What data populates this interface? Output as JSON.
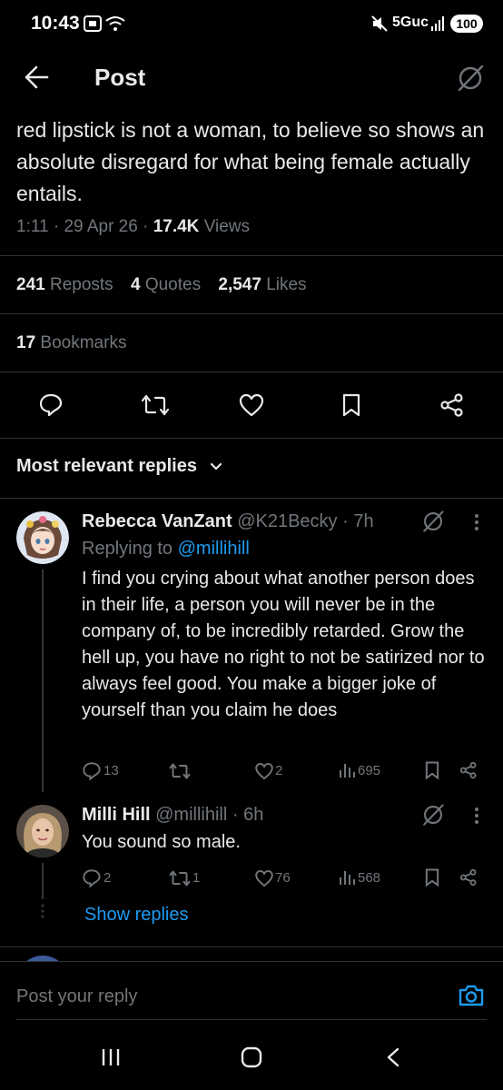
{
  "status_bar": {
    "time": "10:43",
    "network": "5Guc",
    "battery": "100"
  },
  "header": {
    "title": "Post"
  },
  "post": {
    "text": "red lipstick is not a woman, to believe so shows an absolute disregard for what being female actually entails.",
    "time": "1:11",
    "date": "29 Apr 26",
    "views_count": "17.4K",
    "views_label": "Views",
    "reposts_count": "241",
    "reposts_label": "Reposts",
    "quotes_count": "4",
    "quotes_label": "Quotes",
    "likes_count": "2,547",
    "likes_label": "Likes",
    "bookmarks_count": "17",
    "bookmarks_label": "Bookmarks"
  },
  "sort_label": "Most relevant replies",
  "replies": [
    {
      "name": "Rebecca VanZant",
      "handle": "@K21Becky",
      "age": "7h",
      "replying_prefix": "Replying to",
      "replying_handle": "@millihill",
      "text": "I find you crying about what another person does in their life, a person you will never be in the company of, to be incredibly retarded. Grow the hell up, you have no right to not be satirized nor to always feel good. You make a bigger joke of yourself than you claim he does",
      "reply_count": "13",
      "repost_count": "",
      "like_count": "2",
      "view_count": "695"
    },
    {
      "name": "Milli Hill",
      "handle": "@millihill",
      "age": "6h",
      "text": "You sound so male.",
      "reply_count": "2",
      "repost_count": "1",
      "like_count": "76",
      "view_count": "568"
    }
  ],
  "show_replies": "Show replies",
  "compose": {
    "placeholder": "Post your reply"
  },
  "colors": {
    "accent": "#1d9bf0",
    "background": "#000000",
    "muted": "#71767b",
    "text": "#e7e9ea"
  }
}
